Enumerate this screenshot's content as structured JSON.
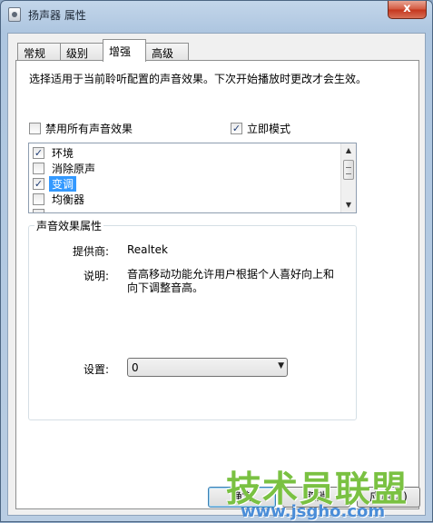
{
  "window": {
    "title": "扬声器 属性",
    "close_label": "x"
  },
  "tabs": [
    {
      "label": "常规",
      "active": false
    },
    {
      "label": "级别",
      "active": false
    },
    {
      "label": "增强",
      "active": true
    },
    {
      "label": "高级",
      "active": false
    }
  ],
  "enhancements": {
    "description": "选择适用于当前聆听配置的声音效果。下次开始播放时更改才会生效。",
    "disable_all": {
      "label": "禁用所有声音效果",
      "checked": false
    },
    "immediate_mode": {
      "label": "立即模式",
      "checked": true
    },
    "effects": [
      {
        "label": "环境",
        "checked": true,
        "selected": false
      },
      {
        "label": "消除原声",
        "checked": false,
        "selected": false
      },
      {
        "label": "变调",
        "checked": true,
        "selected": true
      },
      {
        "label": "均衡器",
        "checked": false,
        "selected": false
      },
      {
        "label": "",
        "checked": false,
        "selected": false
      }
    ]
  },
  "properties": {
    "group_title": "声音效果属性",
    "provider_label": "提供商:",
    "provider_value": "Realtek",
    "description_label": "说明:",
    "description_value": "音高移动功能允许用户根据个人喜好向上和向下调整音高。",
    "setting_label": "设置:",
    "setting_value": "0"
  },
  "buttons": {
    "ok_label": "确定",
    "cancel_label": "取消",
    "apply_label": "应用(A)"
  },
  "watermark": {
    "text": "技术员联盟",
    "url": "www.jsgho.com"
  }
}
